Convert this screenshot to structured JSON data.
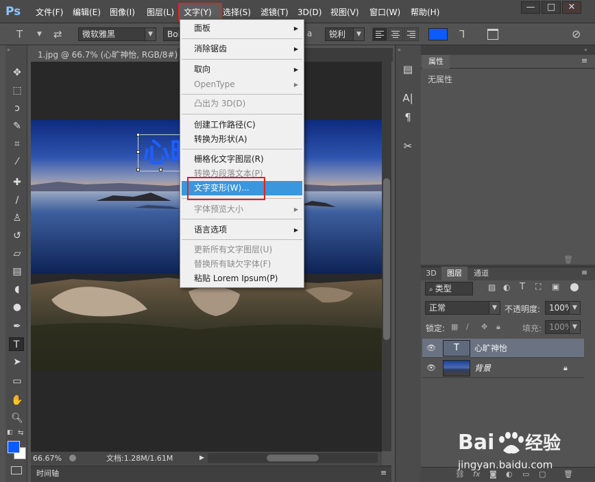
{
  "app": {
    "logo": "Ps"
  },
  "menubar": {
    "items": [
      "文件(F)",
      "编辑(E)",
      "图像(I)",
      "图层(L)",
      "文字(Y)",
      "选择(S)",
      "滤镜(T)",
      "3D(D)",
      "视图(V)",
      "窗口(W)",
      "帮助(H)"
    ],
    "active_index": 4,
    "window_buttons": [
      "—",
      "□",
      "✕"
    ]
  },
  "options_bar": {
    "font_family": "微软雅黑",
    "font_style": "Bold",
    "antialias_prefix": "a",
    "antialias": "锐利",
    "text_color": "#0a5cff",
    "text_tool_icon": "T"
  },
  "document": {
    "tab_title": "1.jpg @ 66.7% (心旷神怡, RGB/8#) *",
    "tab_close": "×",
    "text_layer_preview": "心旷",
    "zoom": "66.67%",
    "doc_info": "文档:1.28M/1.61M",
    "timeline_label": "时间轴"
  },
  "type_menu": {
    "items": [
      {
        "label": "面板",
        "submenu": true,
        "disabled": false
      },
      {
        "label": "消除锯齿",
        "submenu": true,
        "disabled": false
      },
      {
        "label": "取向",
        "submenu": true,
        "disabled": false
      },
      {
        "label": "OpenType",
        "submenu": true,
        "disabled": true
      },
      {
        "label": "凸出为 3D(D)",
        "submenu": false,
        "disabled": true
      },
      {
        "label": "创建工作路径(C)",
        "submenu": false,
        "disabled": false
      },
      {
        "label": "转换为形状(A)",
        "submenu": false,
        "disabled": false
      },
      {
        "label": "栅格化文字图层(R)",
        "submenu": false,
        "disabled": false
      },
      {
        "label": "转换为段落文本(P)",
        "submenu": false,
        "disabled": true
      },
      {
        "label": "文字变形(W)...",
        "submenu": false,
        "disabled": false,
        "highlighted": true
      },
      {
        "label": "字体预览大小",
        "submenu": true,
        "disabled": true
      },
      {
        "label": "语言选项",
        "submenu": true,
        "disabled": false
      },
      {
        "label": "更新所有文字图层(U)",
        "submenu": false,
        "disabled": true
      },
      {
        "label": "替换所有缺欠字体(F)",
        "submenu": false,
        "disabled": true
      },
      {
        "label": "粘贴 Lorem Ipsum(P)",
        "submenu": false,
        "disabled": false
      }
    ]
  },
  "properties_panel": {
    "tab": "属性",
    "empty_text": "无属性"
  },
  "layers_panel": {
    "tabs": [
      "3D",
      "图层",
      "通道"
    ],
    "active_tab": 1,
    "filter_kind": "类型",
    "blend_mode": "正常",
    "opacity_label": "不透明度:",
    "opacity_value": "100%",
    "lock_label": "锁定:",
    "fill_label": "填充:",
    "fill_value": "100%",
    "layers": [
      {
        "name": "心旷神怡",
        "type": "text",
        "thumb": "T",
        "selected": true
      },
      {
        "name": "背景",
        "type": "image",
        "selected": false,
        "locked": true
      }
    ]
  },
  "watermark": {
    "brand": "Bai",
    "brand_suffix": "经验",
    "url": "jingyan.baidu.com"
  }
}
